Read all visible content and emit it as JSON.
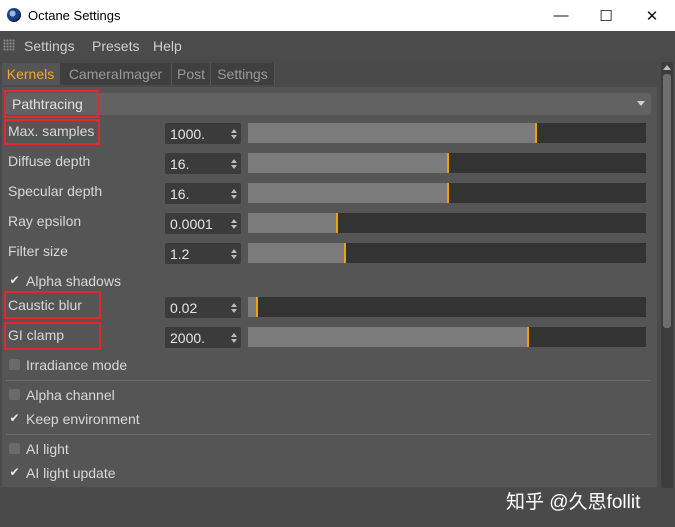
{
  "window": {
    "title": "Octane Settings",
    "minimize": "—",
    "maximize": "☐",
    "close": "✕"
  },
  "menu": [
    "Settings",
    "Presets",
    "Help"
  ],
  "tabs": [
    {
      "label": "Kernels",
      "active": true
    },
    {
      "label": "CameraImager",
      "active": false
    },
    {
      "label": "Post",
      "active": false
    },
    {
      "label": "Settings",
      "active": false
    }
  ],
  "kernel": {
    "selected": "Pathtracing"
  },
  "params": [
    {
      "label": "Max. samples",
      "value": "1000.",
      "slider_fraction": 0.72,
      "highlighted": true
    },
    {
      "label": "Diffuse depth",
      "value": "16.",
      "slider_fraction": 0.5,
      "highlighted": false
    },
    {
      "label": "Specular depth",
      "value": "16.",
      "slider_fraction": 0.5,
      "highlighted": false
    },
    {
      "label": "Ray epsilon",
      "value": "0.0001",
      "slider_fraction": 0.22,
      "highlighted": false
    },
    {
      "label": "Filter size",
      "value": "1.2",
      "slider_fraction": 0.24,
      "highlighted": false
    }
  ],
  "alpha_shadows": {
    "label": "Alpha shadows",
    "checked": true
  },
  "params2": [
    {
      "label": "Caustic blur",
      "value": "0.02",
      "slider_fraction": 0.02,
      "highlighted": true
    },
    {
      "label": "GI clamp",
      "value": "2000.",
      "slider_fraction": 0.7,
      "highlighted": true
    }
  ],
  "checks": [
    {
      "label": "Irradiance mode",
      "checked": false
    },
    {
      "label": "Alpha channel",
      "checked": false
    },
    {
      "label": "Keep environment",
      "checked": true
    },
    {
      "label": "AI light",
      "checked": false
    },
    {
      "label": "AI light update",
      "checked": true
    }
  ],
  "watermark": "知乎 @久思follit",
  "colors": {
    "accent": "#f0a830",
    "highlight_box": "#e0282d",
    "slider_handle": "#f0a000"
  }
}
